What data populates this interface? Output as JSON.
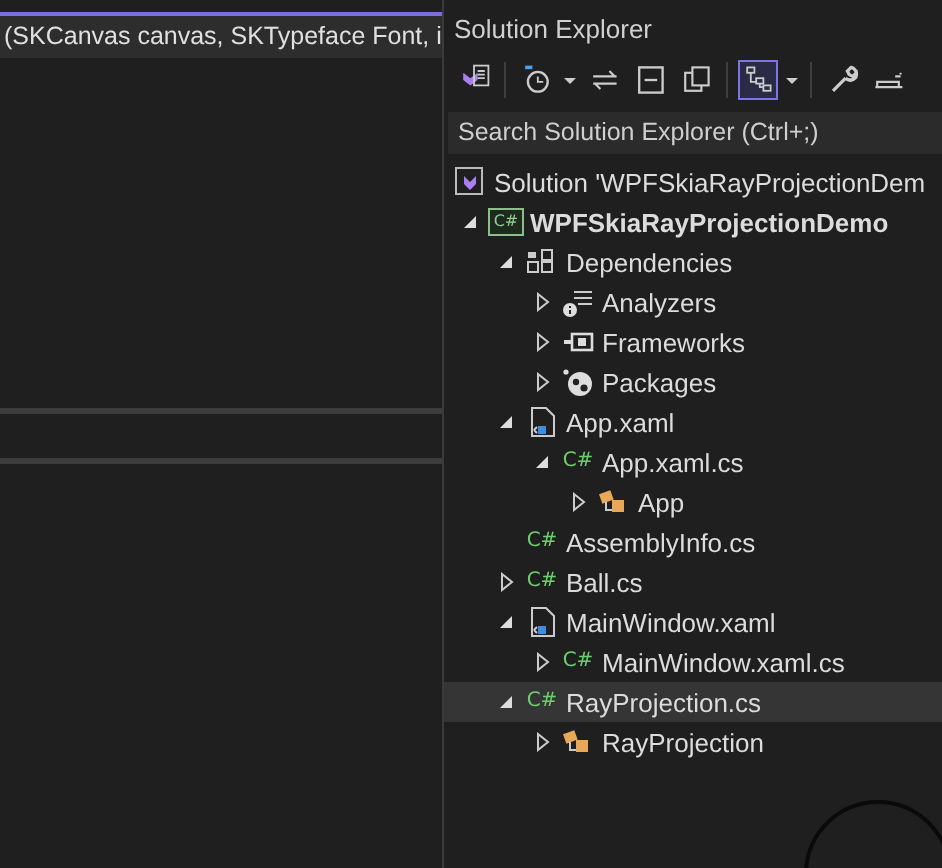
{
  "editor": {
    "signature": "(SKCanvas canvas, SKTypeface Font, i"
  },
  "solution_explorer": {
    "title": "Solution Explorer",
    "toolbar_groups": [
      [
        {
          "kind": "vs-doc",
          "on": false
        }
      ],
      [
        {
          "kind": "history",
          "on": false
        },
        {
          "kind": "dropdown",
          "on": false
        },
        {
          "kind": "sync",
          "on": false
        },
        {
          "kind": "collapse",
          "on": false
        },
        {
          "kind": "copies",
          "on": false
        }
      ],
      [
        {
          "kind": "tree-view",
          "on": true
        },
        {
          "kind": "dropdown",
          "on": false
        }
      ],
      [
        {
          "kind": "wrench",
          "on": false
        },
        {
          "kind": "preview",
          "on": false
        }
      ]
    ],
    "search": {
      "placeholder": "Search Solution Explorer (Ctrl+;)"
    },
    "tree": [
      {
        "label": "Solution 'WPFSkiaRayProjectionDem",
        "kind": "solution",
        "selected": false
      },
      {
        "label": "WPFSkiaRayProjectionDemo",
        "kind": "project",
        "badge": "C#",
        "expanded": true,
        "selected": false,
        "children": [
          {
            "label": "Dependencies",
            "kind": "dependencies",
            "expanded": true,
            "selected": false,
            "children": [
              {
                "label": "Analyzers",
                "kind": "analyzers",
                "expanded": false,
                "selected": false
              },
              {
                "label": "Frameworks",
                "kind": "frameworks",
                "expanded": false,
                "selected": false
              },
              {
                "label": "Packages",
                "kind": "packages",
                "expanded": false,
                "selected": false
              }
            ]
          },
          {
            "label": "App.xaml",
            "kind": "xaml",
            "expanded": true,
            "selected": false,
            "children": [
              {
                "label": "App.xaml.cs",
                "kind": "csharp",
                "badge": "C#",
                "expanded": true,
                "selected": false,
                "children": [
                  {
                    "label": "App",
                    "kind": "class",
                    "expanded": false,
                    "selected": false
                  }
                ]
              }
            ]
          },
          {
            "label": "AssemblyInfo.cs",
            "kind": "csharp",
            "badge": "C#",
            "selected": false
          },
          {
            "label": "Ball.cs",
            "kind": "csharp",
            "badge": "C#",
            "expanded": false,
            "selected": false
          },
          {
            "label": "MainWindow.xaml",
            "kind": "xaml",
            "expanded": true,
            "selected": false,
            "children": [
              {
                "label": "MainWindow.xaml.cs",
                "kind": "csharp",
                "badge": "C#",
                "expanded": false,
                "selected": false
              }
            ]
          },
          {
            "label": "RayProjection.cs",
            "kind": "csharp",
            "badge": "C#",
            "expanded": true,
            "selected": true,
            "children": [
              {
                "label": "RayProjection",
                "kind": "class",
                "expanded": false,
                "selected": false
              }
            ]
          }
        ]
      }
    ]
  }
}
